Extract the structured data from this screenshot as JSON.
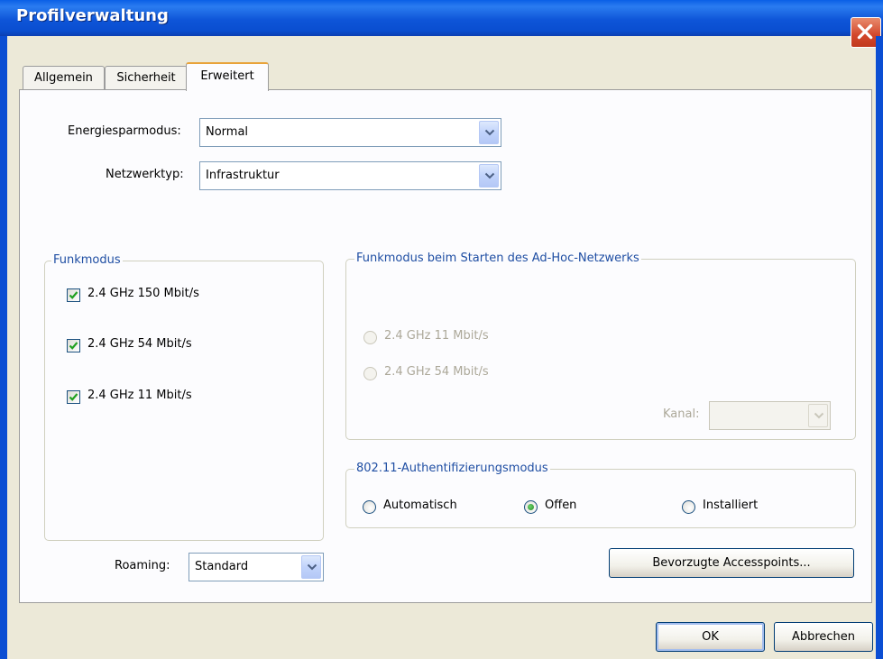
{
  "window": {
    "title": "Profilverwaltung"
  },
  "tabs": [
    {
      "label": "Allgemein"
    },
    {
      "label": "Sicherheit"
    },
    {
      "label": "Erweitert"
    }
  ],
  "power_mode": {
    "label": "Energiesparmodus:",
    "value": "Normal"
  },
  "network_type": {
    "label": "Netzwerktyp:",
    "value": "Infrastruktur"
  },
  "radio_mode": {
    "title": "Funkmodus",
    "options": [
      {
        "label": "2.4 GHz 150 Mbit/s",
        "checked": true
      },
      {
        "label": "2.4 GHz 54 Mbit/s",
        "checked": true
      },
      {
        "label": "2.4 GHz 11 Mbit/s",
        "checked": true
      }
    ]
  },
  "adhoc_mode": {
    "title": "Funkmodus beim Starten des Ad-Hoc-Netzwerks",
    "options": [
      {
        "label": "2.4 GHz 11 Mbit/s",
        "selected": false
      },
      {
        "label": "2.4 GHz 54 Mbit/s",
        "selected": false
      }
    ],
    "channel_label": "Kanal:",
    "channel_value": ""
  },
  "auth_mode": {
    "title": "802.11-Authentifizierungsmodus",
    "options": [
      {
        "label": "Automatisch",
        "selected": false
      },
      {
        "label": "Offen",
        "selected": true
      },
      {
        "label": "Installiert",
        "selected": false
      }
    ]
  },
  "roaming": {
    "label": "Roaming:",
    "value": "Standard"
  },
  "buttons": {
    "preferred_aps": "Bevorzugte Accesspoints...",
    "ok": "OK",
    "cancel": "Abbrechen"
  },
  "colors": {
    "titlebar": "#0a4ed0",
    "dialog_bg": "#ece9d8",
    "group_title": "#1f4ea3",
    "close_button": "#d2462a"
  }
}
